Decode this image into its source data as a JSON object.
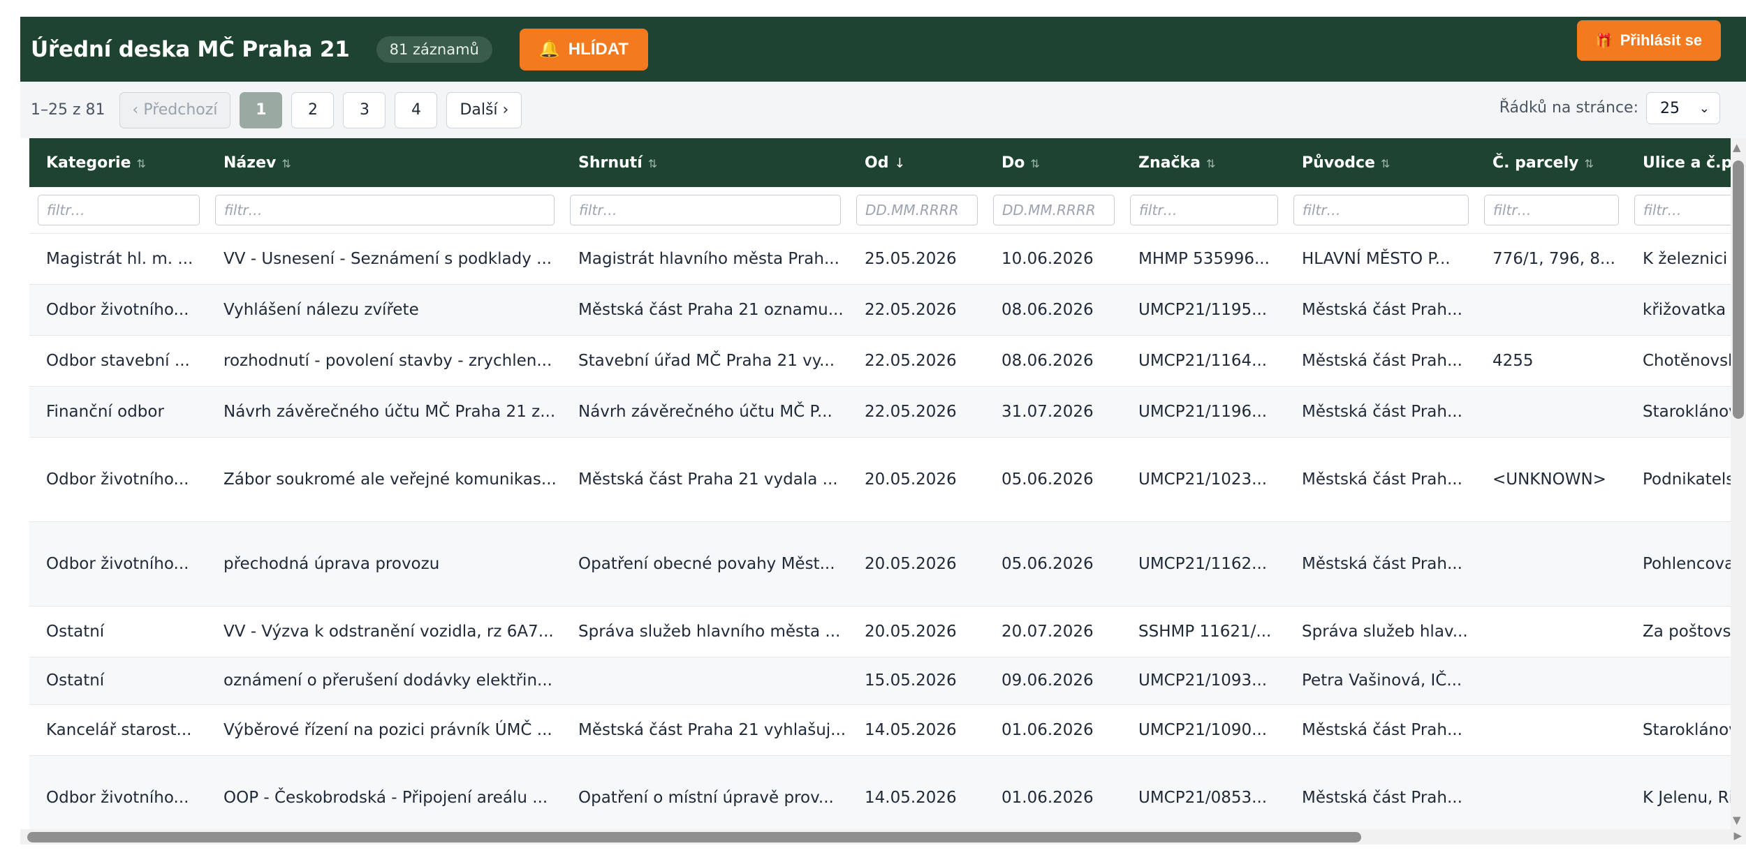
{
  "header": {
    "title": "Úřední deska MČ Praha 21",
    "record_count": "81 záznamů",
    "watch_label": "HLÍDAT",
    "login_label": "Přihlásit se"
  },
  "pagination": {
    "range": "1–25 z 81",
    "prev_label": "‹ Předchozí",
    "pages": [
      "1",
      "2",
      "3",
      "4"
    ],
    "active_page": "1",
    "next_label": "Další ›",
    "rows_label": "Řádků na stránce:",
    "rows_value": "25"
  },
  "table": {
    "columns": [
      {
        "label": "Kategorie",
        "sort": "⇅",
        "filter_placeholder": "filtr…"
      },
      {
        "label": "Název",
        "sort": "⇅",
        "filter_placeholder": "filtr…"
      },
      {
        "label": "Shrnutí",
        "sort": "⇅",
        "filter_placeholder": "filtr…"
      },
      {
        "label": "Od",
        "sort": "↓",
        "filter_placeholder": "DD.MM.RRRR"
      },
      {
        "label": "Do",
        "sort": "⇅",
        "filter_placeholder": "DD.MM.RRRR"
      },
      {
        "label": "Značka",
        "sort": "⇅",
        "filter_placeholder": "filtr…"
      },
      {
        "label": "Původce",
        "sort": "⇅",
        "filter_placeholder": "filtr…"
      },
      {
        "label": "Č. parcely",
        "sort": "⇅",
        "filter_placeholder": "filtr…"
      },
      {
        "label": "Ulice a č.p.",
        "sort": "",
        "filter_placeholder": "filtr…"
      }
    ],
    "rows": [
      [
        "Magistrát hl. m. ...",
        "VV - Usnesení - Seznámení s podklady ...",
        "Magistrát hlavního města Prah...",
        "25.05.2026",
        "10.06.2026",
        "MHMP 535996...",
        "HLAVNÍ MĚSTO P...",
        "776/1, 796, 8...",
        "K železnici"
      ],
      [
        "Odbor životního...",
        "Vyhlášení nálezu zvířete",
        "Městská část Praha 21 oznamu...",
        "22.05.2026",
        "08.06.2026",
        "UMCP21/1195...",
        "Městská část Prah...",
        "",
        "křižovatka u"
      ],
      [
        "Odbor stavební ...",
        "rozhodnutí - povolení stavby - zrychlen...",
        "Stavební úřad MČ Praha 21 vy...",
        "22.05.2026",
        "08.06.2026",
        "UMCP21/1164...",
        "Městská část Prah...",
        "4255",
        "Chotěnovsk"
      ],
      [
        "Finanční odbor",
        "Návrh závěrečného účtu MČ Praha 21 z...",
        "Návrh závěrečného účtu MČ P...",
        "22.05.2026",
        "31.07.2026",
        "UMCP21/1196...",
        "Městská část Prah...",
        "",
        "Staroklánov"
      ],
      [
        "Odbor životního...",
        "Zábor soukromé ale veřejné komunikas...",
        "Městská část Praha 21 vydala ...",
        "20.05.2026",
        "05.06.2026",
        "UMCP21/1023...",
        "Městská část Prah...",
        "<UNKNOWN>",
        "Podnikatels"
      ],
      [
        "Odbor životního...",
        "přechodná úprava provozu",
        "Opatření obecné povahy Měst...",
        "20.05.2026",
        "05.06.2026",
        "UMCP21/1162...",
        "Městská část Prah...",
        "",
        "Pohlencova"
      ],
      [
        "Ostatní",
        "VV - Výzva k odstranění vozidla, rz 6A7...",
        "Správa služeb hlavního města ...",
        "20.05.2026",
        "20.07.2026",
        "SSHMP 11621/...",
        "Správa služeb hlav...",
        "",
        "Za poštovs"
      ],
      [
        "Ostatní",
        "oznámení o přerušení dodávky elektřin...",
        "",
        "15.05.2026",
        "09.06.2026",
        "UMCP21/1093...",
        "Petra Vašinová, IČ...",
        "",
        ""
      ],
      [
        "Kancelář starost...",
        "Výběrové řízení na pozici právník ÚMČ ...",
        "Městská část Praha 21 vyhlašuj...",
        "14.05.2026",
        "01.06.2026",
        "UMCP21/1090...",
        "Městská část Prah...",
        "",
        "Staroklánov"
      ],
      [
        "Odbor životního...",
        "OOP - Českobrodská - Připojení areálu ...",
        "Opatření o místní úpravě prov...",
        "14.05.2026",
        "01.06.2026",
        "UMCP21/0853...",
        "Městská část Prah...",
        "",
        "K Jelenu, Ri"
      ]
    ]
  }
}
